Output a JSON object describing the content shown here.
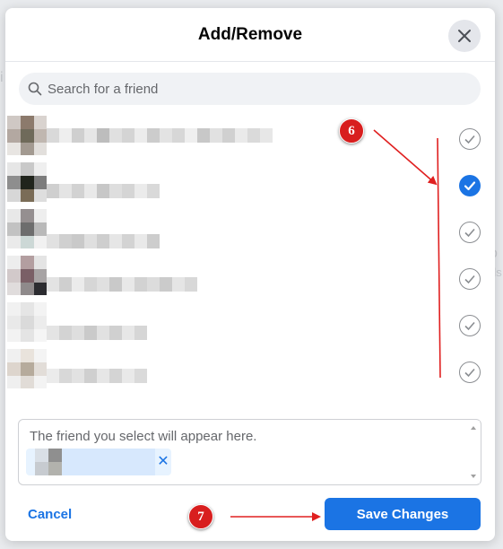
{
  "dialog": {
    "title": "Add/Remove",
    "close_icon": "close-icon"
  },
  "search": {
    "placeholder": "Search for a friend",
    "icon": "search-icon"
  },
  "friends": [
    {
      "selected": false
    },
    {
      "selected": true
    },
    {
      "selected": false
    },
    {
      "selected": false
    },
    {
      "selected": false
    },
    {
      "selected": false
    }
  ],
  "selected_box": {
    "placeholder": "The friend you select will appear here.",
    "remove_glyph": "✕"
  },
  "footer": {
    "cancel_label": "Cancel",
    "save_label": "Save Changes"
  },
  "annotations": [
    {
      "label": "6"
    },
    {
      "label": "7"
    }
  ],
  "colors": {
    "accent": "#1b74e4",
    "annotation": "#d81e1e"
  }
}
